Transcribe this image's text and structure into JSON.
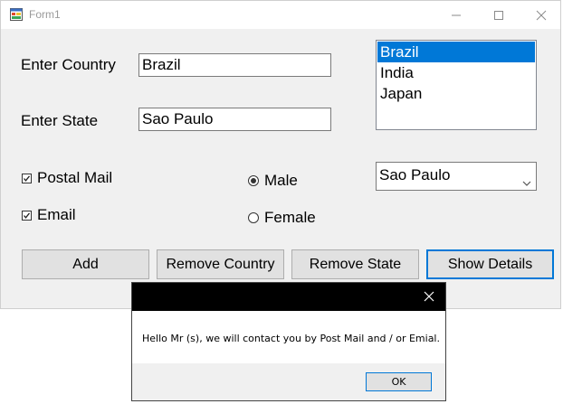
{
  "window": {
    "title": "Form1"
  },
  "labels": {
    "country": "Enter Country",
    "state": "Enter State"
  },
  "inputs": {
    "country_value": "Brazil",
    "state_value": "Sao Paulo"
  },
  "country_list": {
    "items": [
      "Brazil",
      "India",
      "Japan"
    ],
    "selected": "Brazil"
  },
  "checkboxes": [
    {
      "label": "Postal Mail",
      "checked": true
    },
    {
      "label": "Email",
      "checked": true
    }
  ],
  "radios": [
    {
      "label": "Male",
      "checked": true
    },
    {
      "label": "Female",
      "checked": false
    }
  ],
  "state_combo": {
    "selected": "Sao Paulo"
  },
  "buttons": {
    "add": "Add",
    "remove_country": "Remove Country",
    "remove_state": "Remove State",
    "show_details": "Show Details"
  },
  "message_box": {
    "text": "Hello Mr (s), we will contact you by Post Mail and / or Emial.",
    "ok": "OK"
  },
  "colors": {
    "accent": "#0078d7",
    "window_bg": "#f0f0f0"
  }
}
